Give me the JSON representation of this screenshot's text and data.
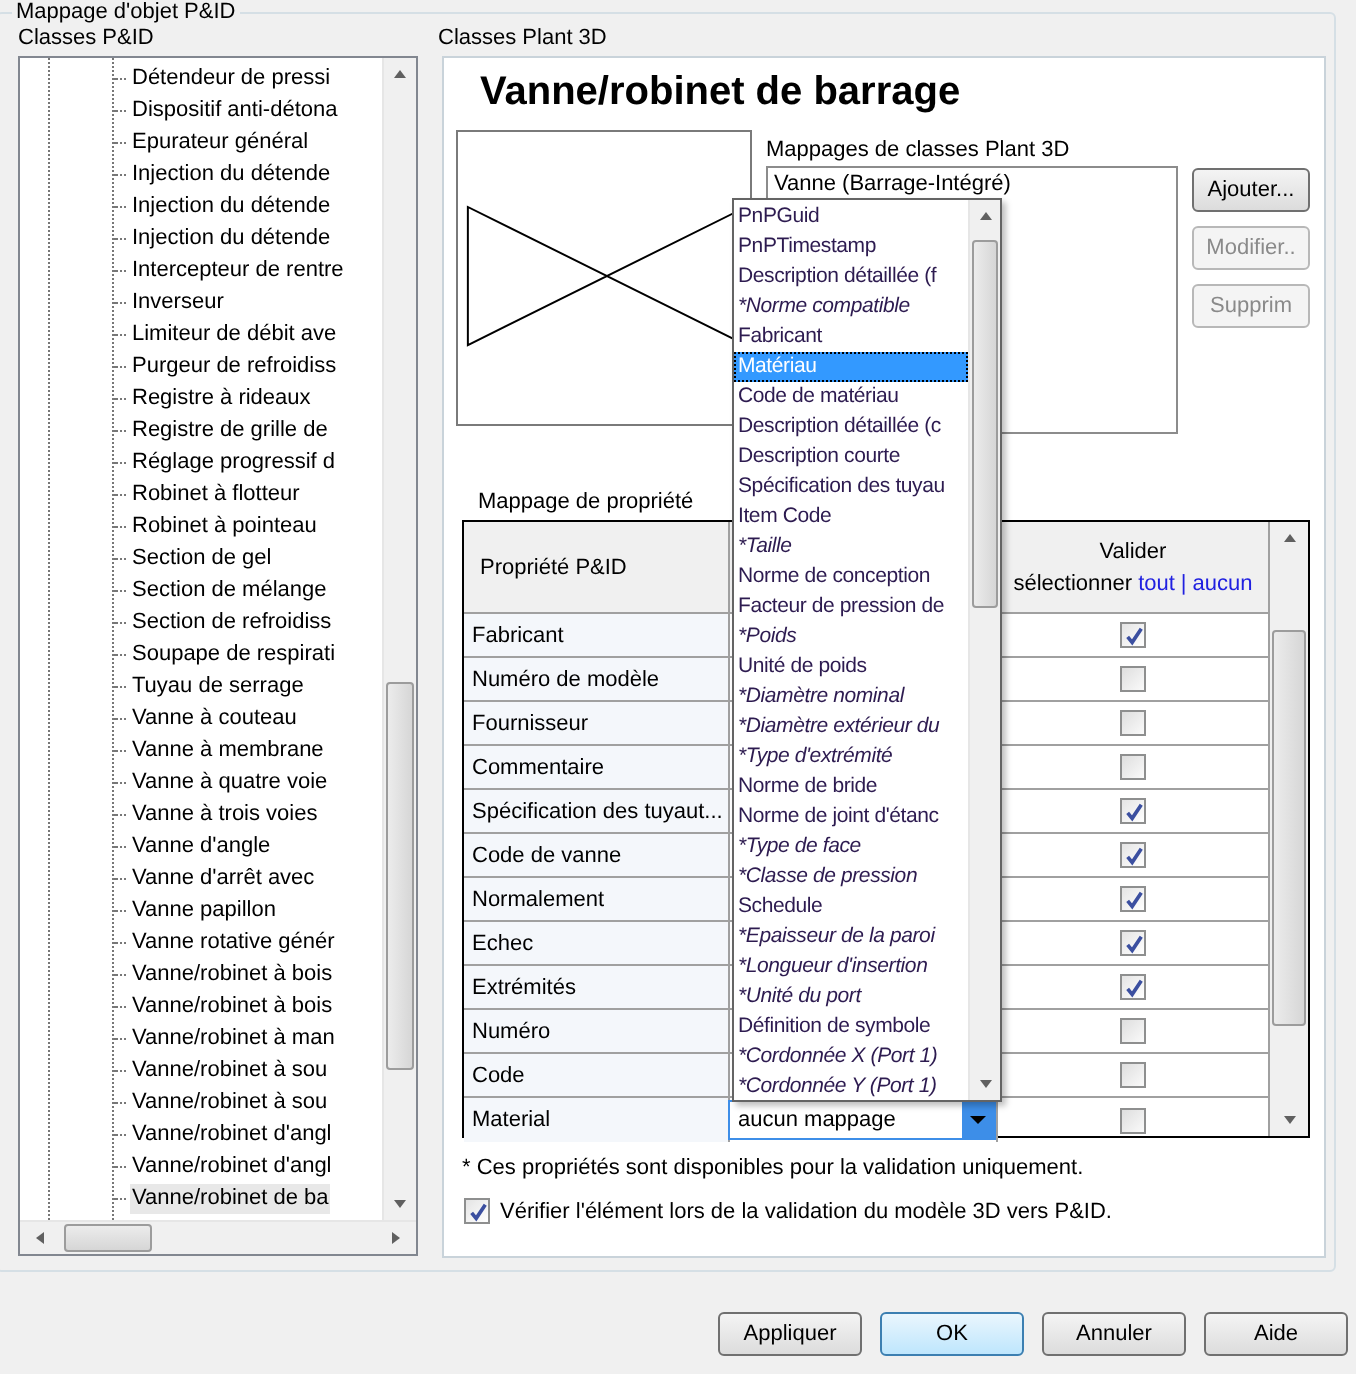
{
  "group_title": "Mappage d'objet P&ID",
  "left": {
    "label": "Classes P&ID",
    "tree_items": [
      {
        "label": "Détendeur de pressi",
        "selected": false
      },
      {
        "label": "Dispositif anti-détona",
        "selected": false
      },
      {
        "label": "Epurateur général",
        "selected": false
      },
      {
        "label": "Injection du détende",
        "selected": false
      },
      {
        "label": "Injection du détende",
        "selected": false
      },
      {
        "label": "Injection du détende",
        "selected": false
      },
      {
        "label": "Intercepteur de rentre",
        "selected": false
      },
      {
        "label": "Inverseur",
        "selected": false
      },
      {
        "label": "Limiteur de débit ave",
        "selected": false
      },
      {
        "label": "Purgeur de refroidiss",
        "selected": false
      },
      {
        "label": "Registre à rideaux",
        "selected": false
      },
      {
        "label": "Registre de grille de",
        "selected": false
      },
      {
        "label": "Réglage progressif d",
        "selected": false
      },
      {
        "label": "Robinet à flotteur",
        "selected": false
      },
      {
        "label": "Robinet à pointeau",
        "selected": false
      },
      {
        "label": "Section de gel",
        "selected": false
      },
      {
        "label": "Section de mélange",
        "selected": false
      },
      {
        "label": "Section de refroidiss",
        "selected": false
      },
      {
        "label": "Soupape de respirati",
        "selected": false
      },
      {
        "label": "Tuyau de serrage",
        "selected": false
      },
      {
        "label": "Vanne à couteau",
        "selected": false
      },
      {
        "label": "Vanne à membrane",
        "selected": false
      },
      {
        "label": "Vanne à quatre voie",
        "selected": false
      },
      {
        "label": "Vanne à trois voies",
        "selected": false
      },
      {
        "label": "Vanne d'angle",
        "selected": false
      },
      {
        "label": "Vanne d'arrêt avec",
        "selected": false
      },
      {
        "label": "Vanne papillon",
        "selected": false
      },
      {
        "label": "Vanne rotative génér",
        "selected": false
      },
      {
        "label": "Vanne/robinet à bois",
        "selected": false
      },
      {
        "label": "Vanne/robinet à bois",
        "selected": false
      },
      {
        "label": "Vanne/robinet à man",
        "selected": false
      },
      {
        "label": "Vanne/robinet à sou",
        "selected": false
      },
      {
        "label": "Vanne/robinet à sou",
        "selected": false
      },
      {
        "label": "Vanne/robinet d'angl",
        "selected": false
      },
      {
        "label": "Vanne/robinet d'angl",
        "selected": false
      },
      {
        "label": "Vanne/robinet de ba",
        "selected": true
      }
    ]
  },
  "right": {
    "label": "Classes Plant 3D",
    "class_title": "Vanne/robinet de barrage",
    "mappings": {
      "label": "Mappages de classes Plant 3D",
      "items": [
        "Vanne (Barrage-Intégré)"
      ]
    },
    "buttons": [
      {
        "label": "Ajouter...",
        "disabled": false
      },
      {
        "label": "Modifier..",
        "disabled": true
      },
      {
        "label": "Supprim",
        "disabled": true
      }
    ],
    "property_mapping": {
      "label": "Mappage de propriété",
      "column_1": "Propriété P&ID",
      "validate_header": {
        "title": "Valider",
        "prefix": "sélectionner",
        "links": [
          "tout",
          "aucun"
        ],
        "separator": "|"
      },
      "rows": [
        {
          "property": "Fabricant",
          "checked": true
        },
        {
          "property": "Numéro de modèle",
          "checked": false
        },
        {
          "property": "Fournisseur",
          "checked": false
        },
        {
          "property": "Commentaire",
          "checked": false
        },
        {
          "property": "Spécification des tuyaut...",
          "checked": true
        },
        {
          "property": "Code de vanne",
          "checked": true
        },
        {
          "property": "Normalement",
          "checked": true
        },
        {
          "property": "Echec",
          "checked": true
        },
        {
          "property": "Extrémités",
          "checked": true
        },
        {
          "property": "Numéro",
          "checked": false
        },
        {
          "property": "Code",
          "checked": false
        },
        {
          "property": "Material",
          "value": "aucun mappage",
          "checked": false
        }
      ]
    },
    "dropdown": {
      "items": [
        {
          "label": "PnPGuid",
          "kind": "property",
          "selected": false
        },
        {
          "label": "PnPTimestamp",
          "kind": "property",
          "selected": false
        },
        {
          "label": "Description détaillée (f",
          "kind": "property",
          "selected": false
        },
        {
          "label": "*Norme compatible",
          "kind": "validation",
          "selected": false
        },
        {
          "label": "Fabricant",
          "kind": "property",
          "selected": false
        },
        {
          "label": "Matériau",
          "kind": "property",
          "selected": true
        },
        {
          "label": "Code de matériau",
          "kind": "property",
          "selected": false
        },
        {
          "label": "Description détaillée (c",
          "kind": "property",
          "selected": false
        },
        {
          "label": "Description courte",
          "kind": "property",
          "selected": false
        },
        {
          "label": "Spécification des tuyau",
          "kind": "property",
          "selected": false
        },
        {
          "label": "Item Code",
          "kind": "property",
          "selected": false
        },
        {
          "label": "*Taille",
          "kind": "validation",
          "selected": false
        },
        {
          "label": "Norme de conception",
          "kind": "property",
          "selected": false
        },
        {
          "label": "Facteur de pression de",
          "kind": "property",
          "selected": false
        },
        {
          "label": "*Poids",
          "kind": "validation",
          "selected": false
        },
        {
          "label": "Unité de poids",
          "kind": "property",
          "selected": false
        },
        {
          "label": "*Diamètre nominal",
          "kind": "validation",
          "selected": false
        },
        {
          "label": "*Diamètre extérieur du",
          "kind": "validation",
          "selected": false
        },
        {
          "label": "*Type d'extrémité",
          "kind": "validation",
          "selected": false
        },
        {
          "label": "Norme de bride",
          "kind": "property",
          "selected": false
        },
        {
          "label": "Norme de joint d'étanc",
          "kind": "property",
          "selected": false
        },
        {
          "label": "*Type de face",
          "kind": "validation",
          "selected": false
        },
        {
          "label": "*Classe de pression",
          "kind": "validation",
          "selected": false
        },
        {
          "label": "Schedule",
          "kind": "property",
          "selected": false
        },
        {
          "label": "*Epaisseur de la paroi",
          "kind": "validation",
          "selected": false
        },
        {
          "label": "*Longueur d'insertion",
          "kind": "validation",
          "selected": false
        },
        {
          "label": "*Unité du port",
          "kind": "validation",
          "selected": false
        },
        {
          "label": "Définition de symbole",
          "kind": "property",
          "selected": false
        },
        {
          "label": "*Cordonnée X (Port 1)",
          "kind": "validation",
          "selected": false
        },
        {
          "label": "*Cordonnée Y (Port 1)",
          "kind": "validation",
          "selected": false
        }
      ]
    },
    "footnote": "* Ces propriétés sont disponibles pour la validation uniquement.",
    "verify": {
      "label": "Vérifier l'élément lors de la validation du modèle 3D vers P&ID.",
      "checked": true
    }
  },
  "buttons": [
    {
      "label": "Appliquer",
      "default": false
    },
    {
      "label": "OK",
      "default": true
    },
    {
      "label": "Annuler",
      "default": false
    },
    {
      "label": "Aide",
      "default": false
    }
  ]
}
